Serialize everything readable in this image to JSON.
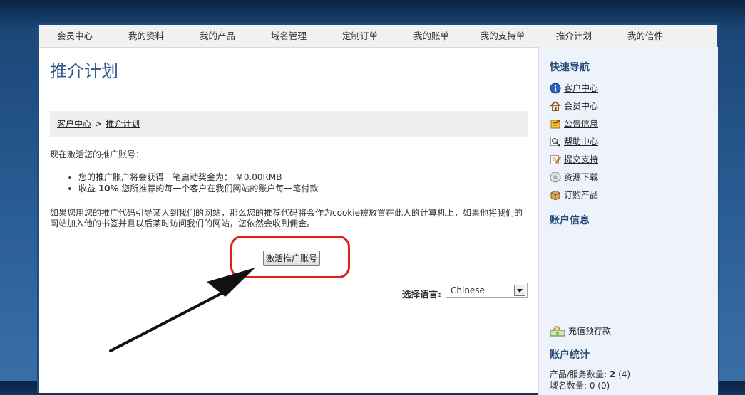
{
  "nav": [
    "会员中心",
    "我的资料",
    "我的产品",
    "域名管理",
    "定制订单",
    "我的账单",
    "我的支持单",
    "推介计划",
    "我的信件"
  ],
  "page_title": "推介计划",
  "breadcrumb": {
    "home": "客户中心",
    "sep": ">",
    "current": "推介计划"
  },
  "intro": "现在激活您的推广账号：",
  "bullets": {
    "b1": "您的推广账户将会获得一笔启动奖金为：  ￥0.00RMB",
    "b2_pre": "收益 ",
    "b2_bold": "10%",
    "b2_post": " 您所推荐的每一个客户在我们网站的账户每一笔付款"
  },
  "paragraph_line1": "如果您用您的推广代码引导某人到我们的网站，那么您的推荐代码将会作为cookie被放置在此人的计算机上，如果他将我们的",
  "paragraph_line2": "网站加入他的书签并且以后某时访问我们的网站，您依然会收到佣金。",
  "activate_button": "激活推广账号",
  "language": {
    "label": "选择语言:",
    "selected": "Chinese"
  },
  "sidebar": {
    "quick_nav_title": "快速导航",
    "links": [
      {
        "label": "客户中心",
        "icon": "info-icon"
      },
      {
        "label": "会员中心",
        "icon": "home-icon"
      },
      {
        "label": "公告信息",
        "icon": "announcement-icon"
      },
      {
        "label": "帮助中心",
        "icon": "magnifier-icon"
      },
      {
        "label": "提交支持",
        "icon": "edit-icon"
      },
      {
        "label": "资源下载",
        "icon": "disc-icon"
      },
      {
        "label": "订购产品",
        "icon": "package-icon"
      }
    ],
    "account_info_title": "账户信息",
    "topup_link": "充值预存款",
    "stats_title": "账户统计",
    "stats": {
      "products_label": "产品/服务数量:",
      "products_count": "2",
      "products_total": "(4)",
      "domains_partial": "域名数量: 0 (0)"
    }
  },
  "colors": {
    "accent": "#2e5a8c",
    "highlight": "#e2201d",
    "sidebar_bg": "#eef3fb"
  }
}
